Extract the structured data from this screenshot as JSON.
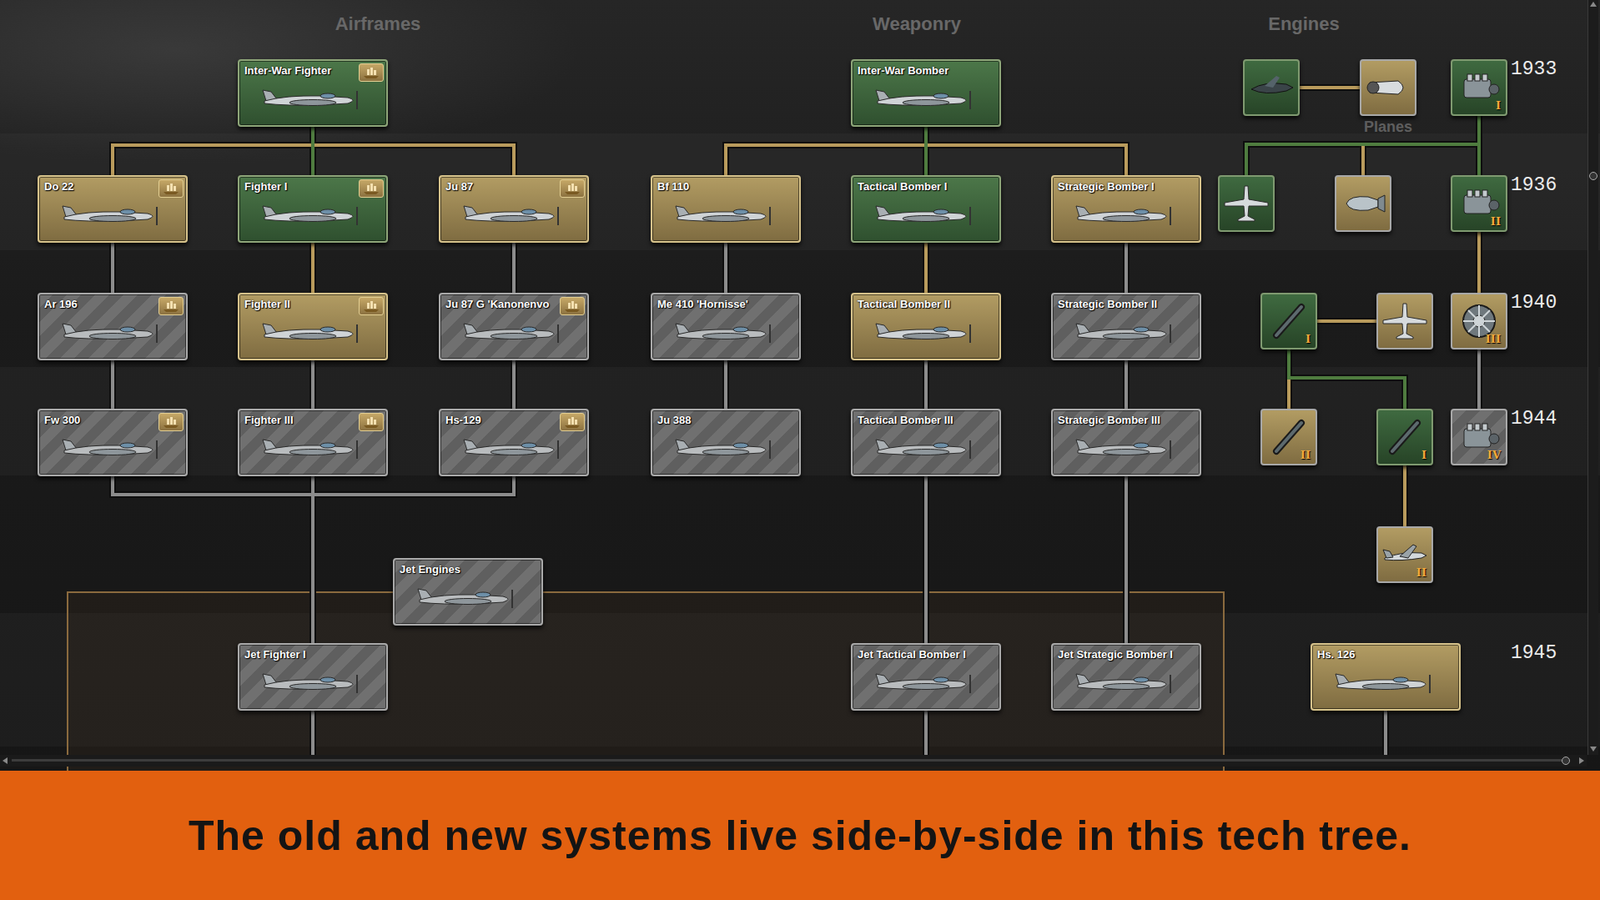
{
  "sections": [
    {
      "title": "Airframes"
    },
    {
      "title": "Weaponry"
    },
    {
      "title": "Engines"
    }
  ],
  "subsection": "Planes",
  "years": [
    "1933",
    "1936",
    "1940",
    "1944",
    "1945"
  ],
  "techs": [
    {
      "label": "Inter-War Fighter",
      "state": "researched",
      "badge": true,
      "parents": [],
      "continues": false
    },
    {
      "label": "Do 22",
      "state": "available",
      "badge": true,
      "parents": [
        "Inter-War Fighter"
      ],
      "continues": false
    },
    {
      "label": "Fighter I",
      "state": "researched",
      "badge": true,
      "parents": [
        "Inter-War Fighter"
      ],
      "continues": false
    },
    {
      "label": "Ju 87",
      "state": "available",
      "badge": true,
      "parents": [
        "Inter-War Fighter"
      ],
      "continues": false
    },
    {
      "label": "Ar 196",
      "state": "locked",
      "badge": true,
      "parents": [
        "Do 22"
      ],
      "continues": false
    },
    {
      "label": "Fighter II",
      "state": "available",
      "badge": true,
      "parents": [
        "Fighter I"
      ],
      "continues": false
    },
    {
      "label": "Ju 87 G 'Kanonenvo",
      "state": "locked",
      "badge": true,
      "parents": [
        "Ju 87"
      ],
      "continues": false
    },
    {
      "label": "Fw 300",
      "state": "locked",
      "badge": true,
      "parents": [
        "Ar 196"
      ],
      "continues": false
    },
    {
      "label": "Fighter III",
      "state": "locked",
      "badge": true,
      "parents": [
        "Fighter II"
      ],
      "continues": false
    },
    {
      "label": "Hs-129",
      "state": "locked",
      "badge": true,
      "parents": [
        "Ju 87 G 'Kanonenvo"
      ],
      "continues": false
    },
    {
      "label": "Inter-War Bomber",
      "state": "researched",
      "badge": false,
      "parents": [],
      "continues": false
    },
    {
      "label": "Bf 110",
      "state": "available",
      "badge": false,
      "parents": [
        "Inter-War Bomber"
      ],
      "continues": false
    },
    {
      "label": "Tactical Bomber I",
      "state": "researched",
      "badge": false,
      "parents": [
        "Inter-War Bomber"
      ],
      "continues": false
    },
    {
      "label": "Strategic Bomber I",
      "state": "available",
      "badge": false,
      "parents": [
        "Inter-War Bomber"
      ],
      "continues": false
    },
    {
      "label": "Me 410 'Hornisse'",
      "state": "locked",
      "badge": false,
      "parents": [
        "Bf 110"
      ],
      "continues": false
    },
    {
      "label": "Tactical Bomber II",
      "state": "available",
      "badge": false,
      "parents": [
        "Tactical Bomber I"
      ],
      "continues": false
    },
    {
      "label": "Strategic Bomber II",
      "state": "locked",
      "badge": false,
      "parents": [
        "Strategic Bomber I"
      ],
      "continues": false
    },
    {
      "label": "Ju 388",
      "state": "locked",
      "badge": false,
      "parents": [
        "Me 410 'Hornisse'"
      ],
      "continues": false
    },
    {
      "label": "Tactical Bomber III",
      "state": "locked",
      "badge": false,
      "parents": [
        "Tactical Bomber II"
      ],
      "continues": false
    },
    {
      "label": "Strategic Bomber III",
      "state": "locked",
      "badge": false,
      "parents": [
        "Strategic Bomber II"
      ],
      "continues": false
    },
    {
      "label": "Jet Engines",
      "state": "locked",
      "badge": false,
      "parents": [],
      "continues": false
    },
    {
      "label": "Jet Fighter I",
      "state": "locked",
      "badge": false,
      "parents": [
        "Fw 300",
        "Fighter III",
        "Hs-129"
      ],
      "continues": true
    },
    {
      "label": "Jet Tactical Bomber I",
      "state": "locked",
      "badge": false,
      "parents": [
        "Tactical Bomber III"
      ],
      "continues": true
    },
    {
      "label": "Jet Strategic Bomber I",
      "state": "locked",
      "badge": false,
      "parents": [
        "Strategic Bomber III"
      ],
      "continues": false
    },
    {
      "label": "Hs. 126",
      "state": "available",
      "badge": false,
      "parents": [],
      "continues": true
    }
  ],
  "components": [
    {
      "kind": "torpedo",
      "tier": "",
      "state": "researched",
      "parents": []
    },
    {
      "kind": "nacelle",
      "tier": "",
      "state": "available",
      "parents": [
        0
      ]
    },
    {
      "kind": "engine",
      "tier": "I",
      "state": "researched",
      "parents": []
    },
    {
      "kind": "plane",
      "tier": "",
      "state": "researched",
      "parents": [
        2
      ]
    },
    {
      "kind": "bomb",
      "tier": "",
      "state": "available",
      "parents": [
        2
      ]
    },
    {
      "kind": "engine",
      "tier": "II",
      "state": "researched",
      "parents": [
        2
      ]
    },
    {
      "kind": "gun",
      "tier": "I",
      "state": "researched",
      "parents": []
    },
    {
      "kind": "plane",
      "tier": "",
      "state": "available",
      "parents": [
        6
      ]
    },
    {
      "kind": "radial",
      "tier": "III",
      "state": "available",
      "parents": [
        5
      ]
    },
    {
      "kind": "gun",
      "tier": "II",
      "state": "available",
      "parents": [
        6
      ]
    },
    {
      "kind": "gun",
      "tier": "I",
      "state": "researched",
      "parents": [
        6
      ]
    },
    {
      "kind": "engine",
      "tier": "IV",
      "state": "locked",
      "parents": [
        8
      ]
    },
    {
      "kind": "jet",
      "tier": "II",
      "state": "available",
      "parents": [
        10
      ]
    }
  ],
  "banner": "The old and new systems live side-by-side in this tech tree."
}
